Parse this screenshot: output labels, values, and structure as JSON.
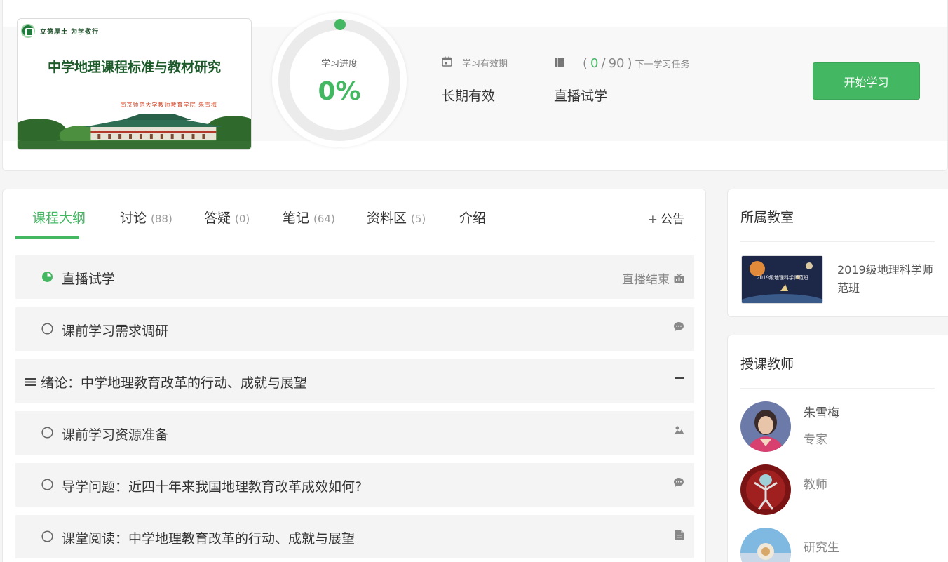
{
  "course": {
    "cover_motto": "立德厚土 为学敬行",
    "cover_title": "中学地理课程标准与教材研究",
    "cover_author": "南京师范大学教师教育学院 朱雪梅"
  },
  "progress": {
    "label": "学习进度",
    "value_text": "0%",
    "fraction": 0
  },
  "validity": {
    "label": "学习有效期",
    "value": "长期有效",
    "icon": "calendar-icon"
  },
  "task": {
    "open_paren": "(",
    "done": "0",
    "slash": "/",
    "total": "90",
    "close_paren": ")",
    "label": "下一学习任务",
    "value": "直播试学",
    "icon": "book-icon"
  },
  "start_button": "开始学习",
  "tabs": [
    {
      "label": "课程大纲",
      "count": ""
    },
    {
      "label": "讨论",
      "count": "(88)"
    },
    {
      "label": "答疑",
      "count": "(0)"
    },
    {
      "label": "笔记",
      "count": "(64)"
    },
    {
      "label": "资料区",
      "count": "(5)"
    },
    {
      "label": "介绍",
      "count": ""
    }
  ],
  "announce": {
    "plus": "+",
    "label": "公告"
  },
  "outline": [
    {
      "title": "直播试学",
      "status": "直播结束",
      "mark": "half-circle-icon",
      "icon": "tv-icon"
    },
    {
      "title": "课前学习需求调研",
      "status": "",
      "mark": "empty-circle-icon",
      "icon": "chat-bubble-icon"
    },
    {
      "title": "绪论：中学地理教育改革的行动、成就与展望",
      "status": "",
      "mark": "list-icon",
      "icon": "minus-icon"
    },
    {
      "title": "课前学习资源准备",
      "status": "",
      "mark": "empty-circle-icon",
      "icon": "image-icon"
    },
    {
      "title": "导学问题：近四十年来我国地理教育改革成效如何?",
      "status": "",
      "mark": "empty-circle-icon",
      "icon": "chat-bubble-icon"
    },
    {
      "title": "课堂阅读：中学地理教育改革的行动、成就与展望",
      "status": "",
      "mark": "empty-circle-icon",
      "icon": "document-icon"
    }
  ],
  "classroom": {
    "heading": "所属教室",
    "name": "2019级地理科学师范班",
    "thumb_text": "2019级地理科学师范班"
  },
  "teachers": {
    "heading": "授课教师",
    "list": [
      {
        "name": "朱雪梅",
        "role": "专家"
      },
      {
        "name": "",
        "role": "教师"
      },
      {
        "name": "",
        "role": "研究生"
      }
    ]
  },
  "colors": {
    "accent": "#44b762",
    "row_bg": "#f4f4f4"
  }
}
